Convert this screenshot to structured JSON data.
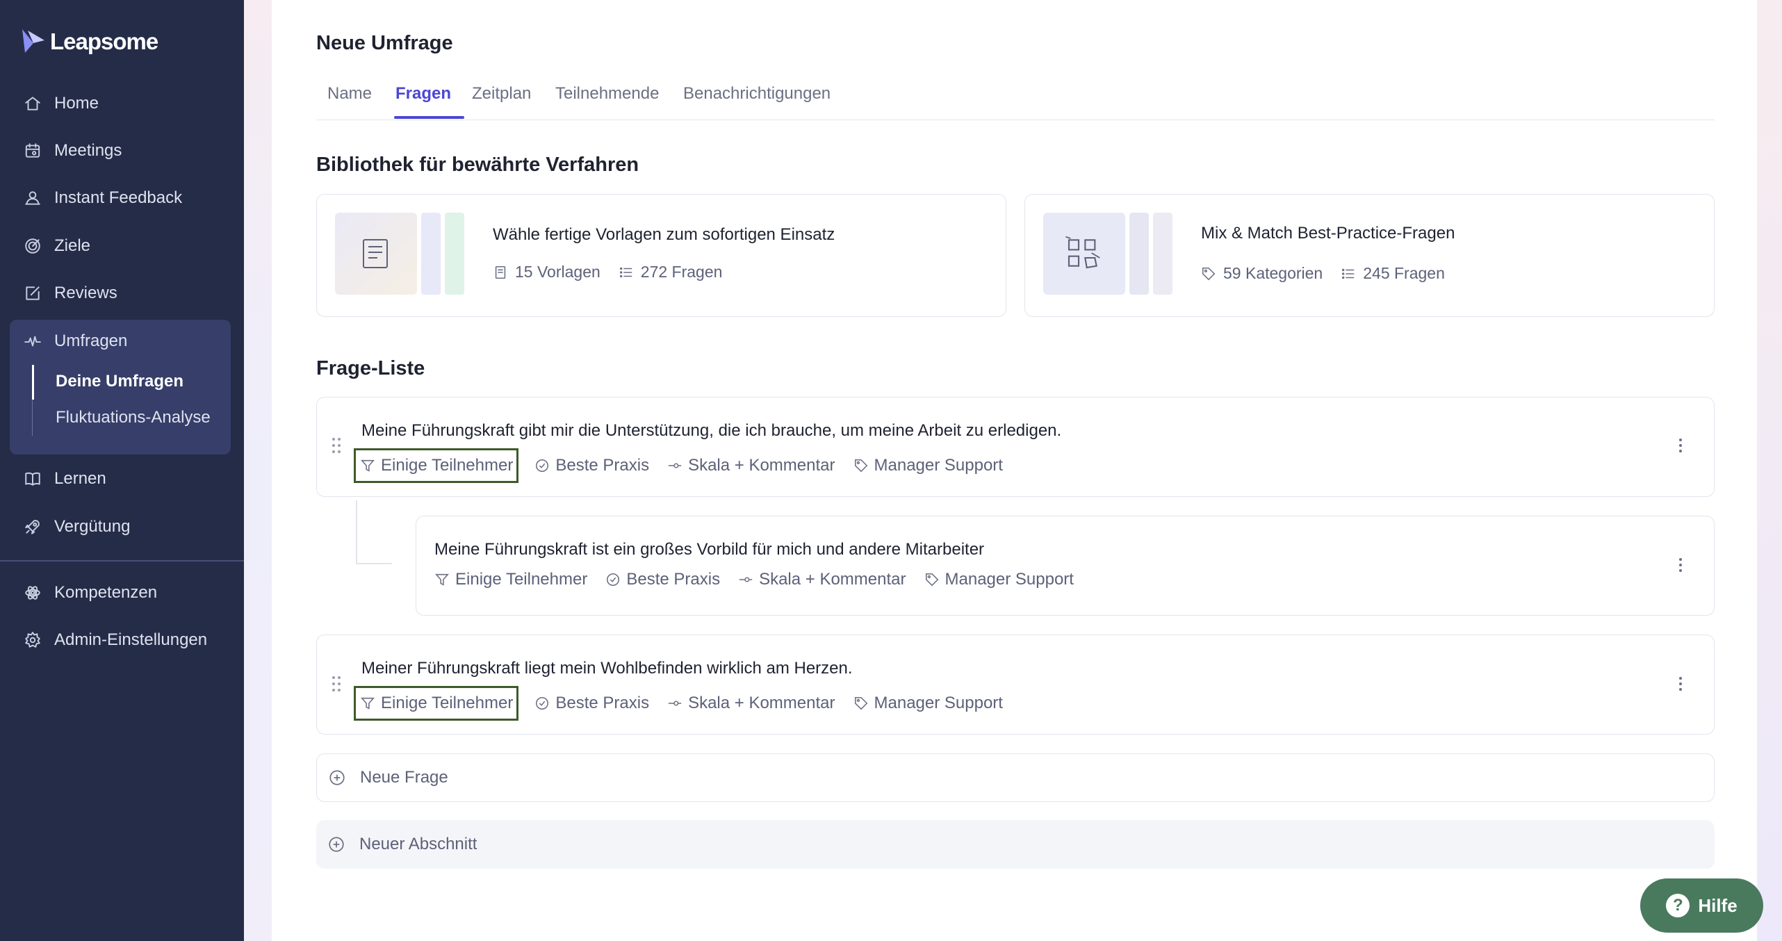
{
  "brand": {
    "name": "Leapsome"
  },
  "sidebar": {
    "items": [
      {
        "label": "Home",
        "icon": "home-icon"
      },
      {
        "label": "Meetings",
        "icon": "calendar-icon"
      },
      {
        "label": "Instant Feedback",
        "icon": "feedback-icon"
      },
      {
        "label": "Ziele",
        "icon": "target-icon"
      },
      {
        "label": "Reviews",
        "icon": "edit-icon"
      },
      {
        "label": "Umfragen",
        "icon": "pulse-icon"
      },
      {
        "label": "Lernen",
        "icon": "book-icon"
      },
      {
        "label": "Vergütung",
        "icon": "rocket-icon"
      },
      {
        "label": "Kompetenzen",
        "icon": "atom-icon"
      },
      {
        "label": "Admin-Einstellungen",
        "icon": "gear-icon"
      }
    ],
    "sub_items": [
      "Deine Umfragen",
      "Fluktuations-Analyse"
    ]
  },
  "page": {
    "title": "Neue Umfrage",
    "tabs": [
      "Name",
      "Fragen",
      "Zeitplan",
      "Teilnehmende",
      "Benachrichtigungen"
    ],
    "active_tab": "Fragen"
  },
  "library": {
    "title": "Bibliothek für bewährte Verfahren",
    "cards": [
      {
        "title": "Wähle fertige Vorlagen zum sofortigen Einsatz",
        "meta1": "15 Vorlagen",
        "meta2": "272 Fragen"
      },
      {
        "title": "Mix & Match Best-Practice-Fragen",
        "meta1": "59 Kategorien",
        "meta2": "245 Fragen"
      }
    ]
  },
  "questions": {
    "title": "Frage-Liste",
    "items": [
      {
        "text": "Meine Führungskraft gibt mir die Unterstützung, die ich brauche, um meine Arbeit zu erledigen.",
        "filter": "Einige Teilnehmer",
        "badge": "Beste Praxis",
        "type": "Skala + Kommentar",
        "tag": "Manager Support"
      },
      {
        "text": "Meine Führungskraft ist ein großes Vorbild für mich und andere Mitarbeiter",
        "filter": "Einige Teilnehmer",
        "badge": "Beste Praxis",
        "type": "Skala + Kommentar",
        "tag": "Manager Support"
      },
      {
        "text": "Meiner Führungskraft liegt mein Wohlbefinden wirklich am Herzen.",
        "filter": "Einige Teilnehmer",
        "badge": "Beste Praxis",
        "type": "Skala + Kommentar",
        "tag": "Manager Support"
      }
    ],
    "add_question": "Neue Frage",
    "add_section": "Neuer Abschnitt"
  },
  "help": {
    "label": "Hilfe"
  },
  "colors": {
    "sidebar": "#242c48",
    "accent": "#4b46d6",
    "help": "#4a7a5e",
    "highlight": "#3f5a2a"
  }
}
